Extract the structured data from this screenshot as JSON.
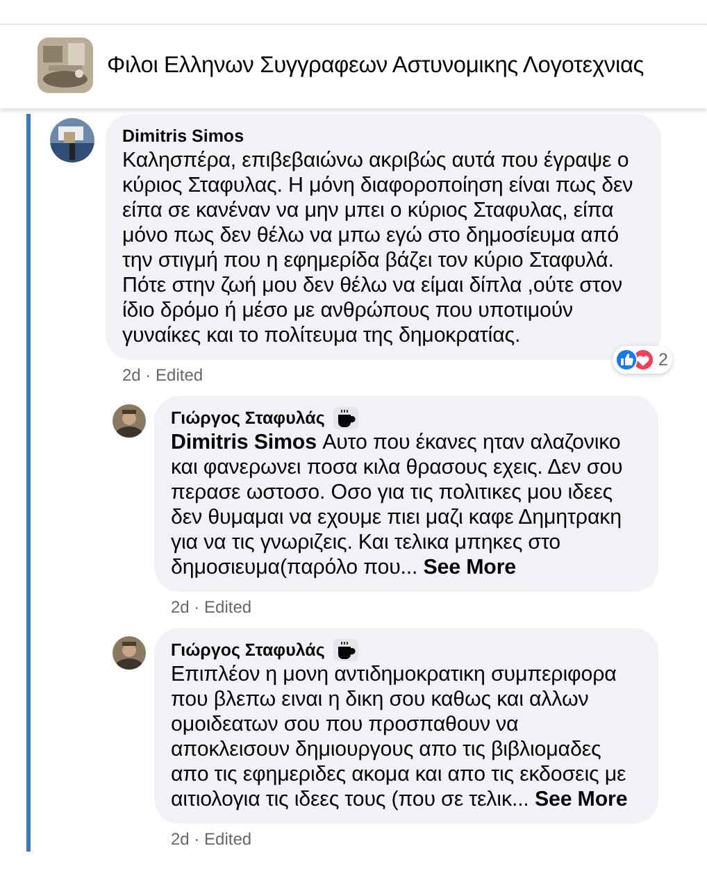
{
  "group": {
    "title": "Φιλοι Ελληνων Συγγραφεων Αστυνομικης Λογοτεχνιας"
  },
  "comments": [
    {
      "kind": "comment",
      "author": "Dimitris Simos",
      "text": "Καλησπέρα, επιβεβαιώνω ακριβώς αυτά που έγραψε ο κύριος Σταφυλας. Η μόνη διαφοροποίηση είναι πως δεν είπα σε κανέναν να μην μπει ο κύριος Σταφυλας, είπα μόνο πως δεν θέλω να μπω εγώ στο δημοσίευμα από την στιγμή που η εφημερίδα βάζει τον κύριο Σταφυλά. Πότε στην ζωή μου δεν θέλω να είμαι δίπλα ,ούτε στον ίδιο δρόμο ή μέσο με ανθρώπους που υποτιμούν γυναίκες και το πολίτευμα της δημοκρατίας.",
      "meta": "2d · Edited",
      "reactions": {
        "icons": [
          {
            "kind": "like"
          },
          {
            "kind": "love"
          }
        ],
        "count": "2"
      }
    },
    {
      "kind": "reply",
      "author": "Γιώργος Σταφυλάς",
      "badge": {
        "kind": "coffee"
      },
      "text": "**Dimitris Simos** Αυτο που έκανες ηταν αλαζονικο και φανερωνει ποσα κιλα θρασους εχεις. Δεν σου περασε ωστοσο. Οσο για τις πολιτικες μου ιδεες δεν θυμαμαι να εχουμε πιει μαζι καφε Δημητρακη για να τις γνωριζεις. Και τελικα μπηκες στο δημοσιευμα(παρόλο που...",
      "see_more": "See More",
      "meta": "2d · Edited"
    },
    {
      "kind": "reply",
      "author": "Γιώργος Σταφυλάς",
      "badge": {
        "kind": "coffee"
      },
      "text": "Επιπλέον η μονη αντιδημοκρατικη συμπεριφορα που βλεπω ειναι η δικη σου καθως και αλλων ομοιδεατων σου που προσπαθουν να αποκλεισουν δημιουργους απο τις βιβλιομαδες απο τις εφημεριδες ακομα και απο τις εκδοσεις με αιτιολογια τις ιδεες τους (που σε τελικ...",
      "see_more": "See More",
      "meta": "2d · Edited"
    }
  ]
}
